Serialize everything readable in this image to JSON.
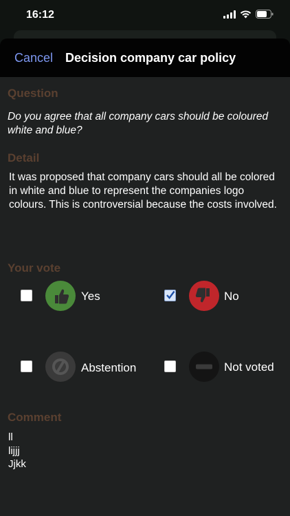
{
  "status_bar": {
    "time": "16:12"
  },
  "nav": {
    "cancel_label": "Cancel",
    "title": "Decision company car policy"
  },
  "question": {
    "label": "Question",
    "text": "Do you agree that all company cars should be coloured white and blue?"
  },
  "detail": {
    "label": "Detail",
    "text": "It was proposed that company cars should all be colored in white and blue to represent the companies logo colours. This is controversial because the costs involved."
  },
  "vote": {
    "label": "Your vote",
    "options": [
      {
        "label": "Yes",
        "checked": false,
        "icon": "thumbs-up-icon",
        "color": "#4a8a3a"
      },
      {
        "label": "No",
        "checked": true,
        "icon": "thumbs-down-icon",
        "color": "#c0262b"
      },
      {
        "label": "Abstention",
        "checked": false,
        "icon": "abstain-icon",
        "color": "#3a3a3a"
      },
      {
        "label": "Not voted",
        "checked": false,
        "icon": "not-voted-icon",
        "color": "#1a1a1a"
      }
    ]
  },
  "comment": {
    "label": "Comment",
    "text": "ll\nlijjj\nJjkk"
  }
}
